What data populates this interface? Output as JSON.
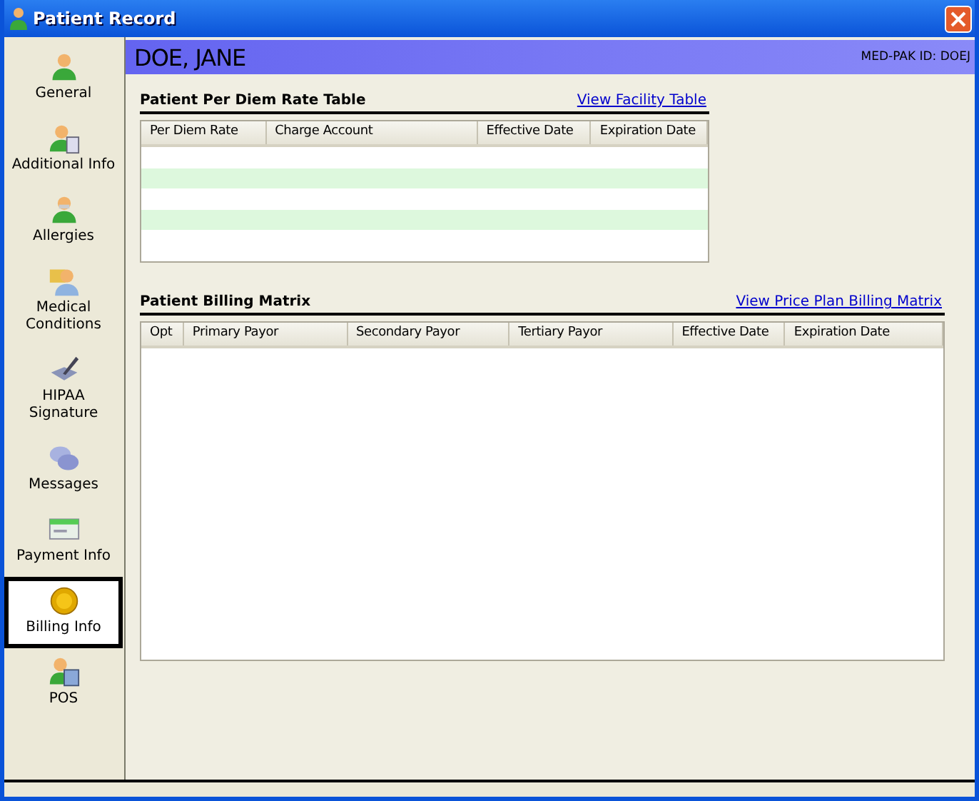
{
  "window": {
    "title": "Patient Record"
  },
  "sidebar": {
    "items": [
      {
        "label": "General",
        "kind": "person",
        "selected": false
      },
      {
        "label": "Additional Info",
        "kind": "person-doc",
        "selected": false
      },
      {
        "label": "Allergies",
        "kind": "person-mask",
        "selected": false
      },
      {
        "label": "Medical Conditions",
        "kind": "doctor",
        "selected": false
      },
      {
        "label": "HIPAA Signature",
        "kind": "pen",
        "selected": false
      },
      {
        "label": "Messages",
        "kind": "chat",
        "selected": false
      },
      {
        "label": "Payment Info",
        "kind": "check",
        "selected": false
      },
      {
        "label": "Billing Info",
        "kind": "coin",
        "selected": true
      },
      {
        "label": "POS",
        "kind": "register",
        "selected": false
      }
    ]
  },
  "header": {
    "patient_name": "DOE, JANE",
    "id_label": "MED-PAK ID: DOEJ"
  },
  "per_diem_table": {
    "title": "Patient Per Diem Rate Table",
    "link": "View Facility Table",
    "columns": [
      "Per Diem Rate",
      "Charge Account",
      "Effective Date",
      "Expiration Date"
    ]
  },
  "billing_matrix": {
    "title": "Patient Billing Matrix",
    "link": "View Price Plan Billing Matrix",
    "columns": [
      "Opt",
      "Primary Payor",
      "Secondary Payor",
      "Tertiary Payor",
      "Effective Date",
      "Expiration Date"
    ]
  }
}
